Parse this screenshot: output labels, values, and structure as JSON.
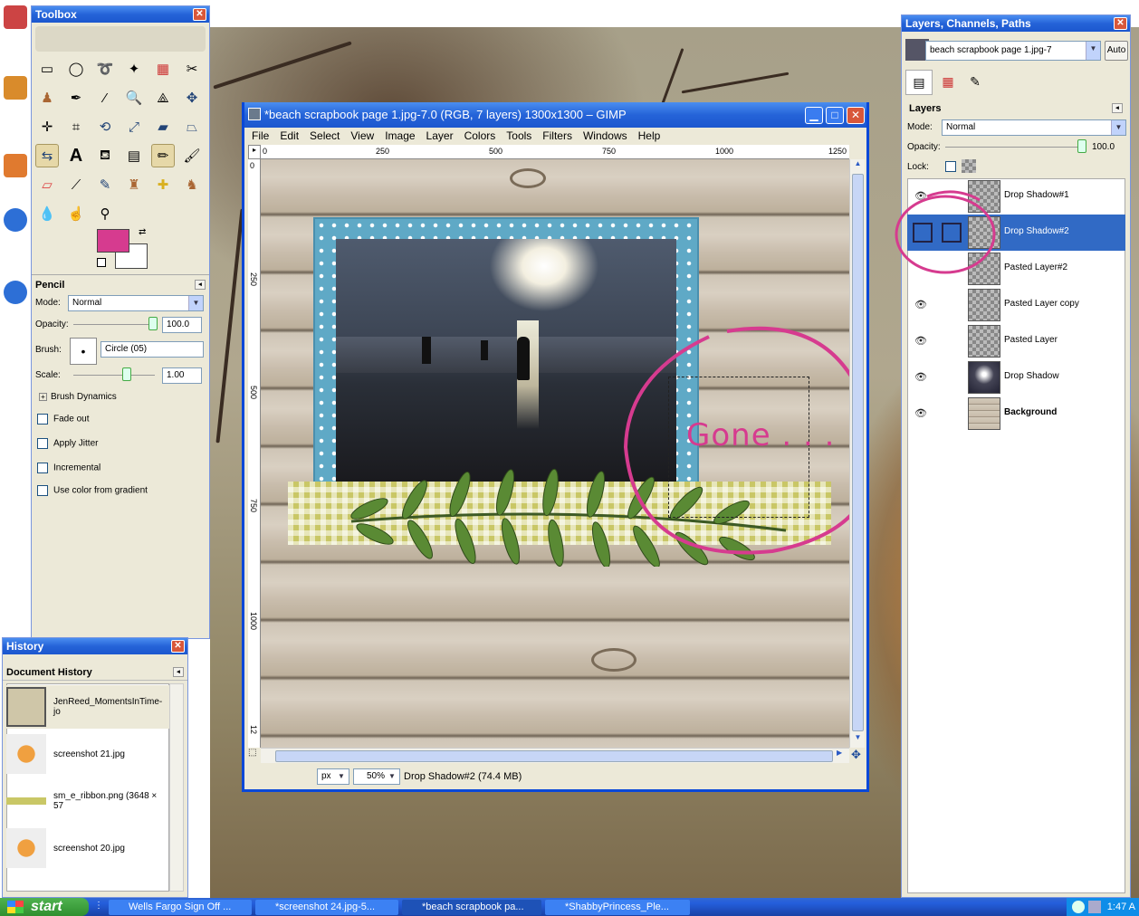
{
  "toolbox": {
    "title": "Toolbox",
    "tool_options_title": "Pencil",
    "mode_label": "Mode:",
    "mode_value": "Normal",
    "opacity_label": "Opacity:",
    "opacity_value": "100.0",
    "brush_label": "Brush:",
    "brush_value": "Circle (05)",
    "scale_label": "Scale:",
    "scale_value": "1.00",
    "brush_dynamics": "Brush Dynamics",
    "options": [
      "Fade out",
      "Apply Jitter",
      "Incremental",
      "Use color from gradient"
    ],
    "fg_color": "#d63b8f",
    "bg_color": "#ffffff"
  },
  "history": {
    "title": "History",
    "panel_title": "Document History",
    "items": [
      "JenReed_MomentsInTime-jo",
      "screenshot 21.jpg",
      "sm_e_ribbon.png (3648 × 57",
      "screenshot 20.jpg"
    ]
  },
  "layers": {
    "title": "Layers, Channels, Paths",
    "image_select": "beach scrapbook page 1.jpg-7",
    "auto_label": "Auto",
    "panel_title": "Layers",
    "mode_label": "Mode:",
    "mode_value": "Normal",
    "opacity_label": "Opacity:",
    "opacity_value": "100.0",
    "lock_label": "Lock:",
    "items": [
      "Drop Shadow#1",
      "Drop Shadow#2",
      "Pasted Layer#2",
      "Pasted Layer copy",
      "Pasted Layer",
      "Drop Shadow",
      "Background"
    ]
  },
  "image_window": {
    "title": "*beach scrapbook page 1.jpg-7.0 (RGB, 7 layers) 1300x1300 – GIMP",
    "menu": [
      "File",
      "Edit",
      "Select",
      "View",
      "Image",
      "Layer",
      "Colors",
      "Tools",
      "Filters",
      "Windows",
      "Help"
    ],
    "ruler_ticks": [
      "0",
      "250",
      "500",
      "750",
      "1000",
      "1250"
    ],
    "vruler_ticks": [
      "0",
      "250",
      "500",
      "750",
      "1000",
      "12"
    ],
    "canvas_text": "Gone . . .",
    "unit": "px",
    "zoom": "50%",
    "status": "Drop Shadow#2 (74.4 MB)"
  },
  "taskbar": {
    "start": "start",
    "tasks": [
      "Wells Fargo Sign Off ...",
      "*screenshot 24.jpg-5...",
      "*beach scrapbook pa...",
      "*ShabbyPrincess_Ple..."
    ],
    "clock": "1:47 A"
  },
  "colors": {
    "annotation": "#d63b8f",
    "selection": "#316ac5",
    "frame_blue": "#5fa9c6",
    "ribbon": "#c9c766"
  }
}
